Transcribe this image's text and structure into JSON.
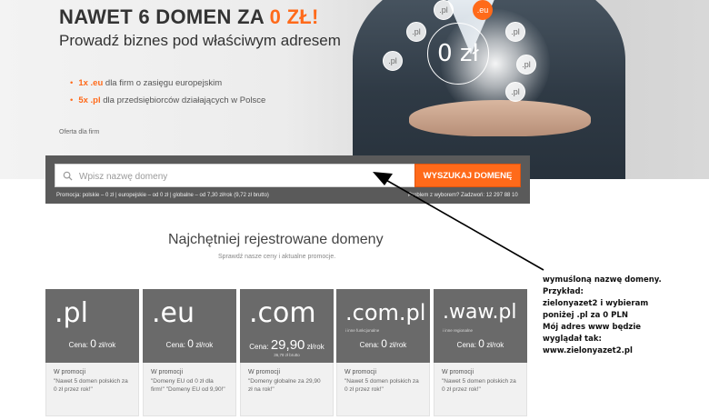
{
  "hero": {
    "headline_prefix": "NAWET 6 DOMEN ZA ",
    "headline_accent": "0 ZŁ!",
    "subheadline": "Prowadź biznes pod właściwym adresem",
    "bullets": [
      {
        "highlight": "1x .eu",
        "text": " dla firm o zasięgu europejskim"
      },
      {
        "highlight": "5x .pl",
        "text": " dla przedsiębiorców działających w Polsce"
      }
    ],
    "oferta_label": "Oferta dla firm",
    "zero_price_label": "0 zł",
    "bubbles": [
      ".pl",
      ".eu",
      ".pl",
      ".pl",
      ".pl",
      ".pl",
      ".pl"
    ],
    "accent_color": "#ff6a1a"
  },
  "search": {
    "placeholder": "Wpisz nazwę domeny",
    "value": "",
    "button_label": "WYSZUKAJ DOMENĘ",
    "promo_text": "Promocja: polskie – 0 zł | europejskie – od 0 zł | globalne – od 7,30 zł/rok (9,72 zł brutto)",
    "help_text": "Problem z wyborem? Zadzwoń: 12 297 88 10"
  },
  "popular": {
    "title": "Najchętniej rejestrowane domeny",
    "subtitle": "Sprawdź nasze ceny i aktualne promocje."
  },
  "tiles": [
    {
      "name": ".pl",
      "note": "",
      "price_label": "Cena:",
      "price": "0",
      "unit": "zł/rok",
      "sub": "",
      "promo_label": "W promocji",
      "promo_text": "\"Nawet 5 domen polskich za 0 zł przez rok!\""
    },
    {
      "name": ".eu",
      "note": "",
      "price_label": "Cena:",
      "price": "0",
      "unit": "zł/rok",
      "sub": "",
      "promo_label": "W promocji",
      "promo_text": "\"Domeny EU od 0 zł dla firm!\" \"Domeny EU od 9,90!\""
    },
    {
      "name": ".com",
      "note": "",
      "price_label": "Cena:",
      "price": "29,90",
      "unit": "zł/rok",
      "sub": "36,78 zł brutto",
      "promo_label": "W promocji",
      "promo_text": "\"Domeny globalne za 29,90 zł na rok!\""
    },
    {
      "name": ".com.pl",
      "note": "i inne funkcjonalne",
      "price_label": "Cena:",
      "price": "0",
      "unit": "zł/rok",
      "sub": "",
      "promo_label": "W promocji",
      "promo_text": "\"Nawet 5 domen polskich za 0 zł przez rok!\""
    },
    {
      "name": ".waw.pl",
      "note": "i inne regionalne",
      "price_label": "Cena:",
      "price": "0",
      "unit": "zł/rok",
      "sub": "",
      "promo_label": "W promocji",
      "promo_text": "\"Nawet 5 domen polskich za 0 zł przez rok!\""
    }
  ],
  "annotation": {
    "line1": "wymuśloną nazwę domeny.",
    "line2": "Przykład:",
    "line3": "zielonyazet2 i wybieram",
    "line4": "poniżej .pl za 0 PLN",
    "line5": "Mój adres www będzie",
    "line6": "wyglądał tak:",
    "line7": "www.zielonyazet2.pl"
  }
}
